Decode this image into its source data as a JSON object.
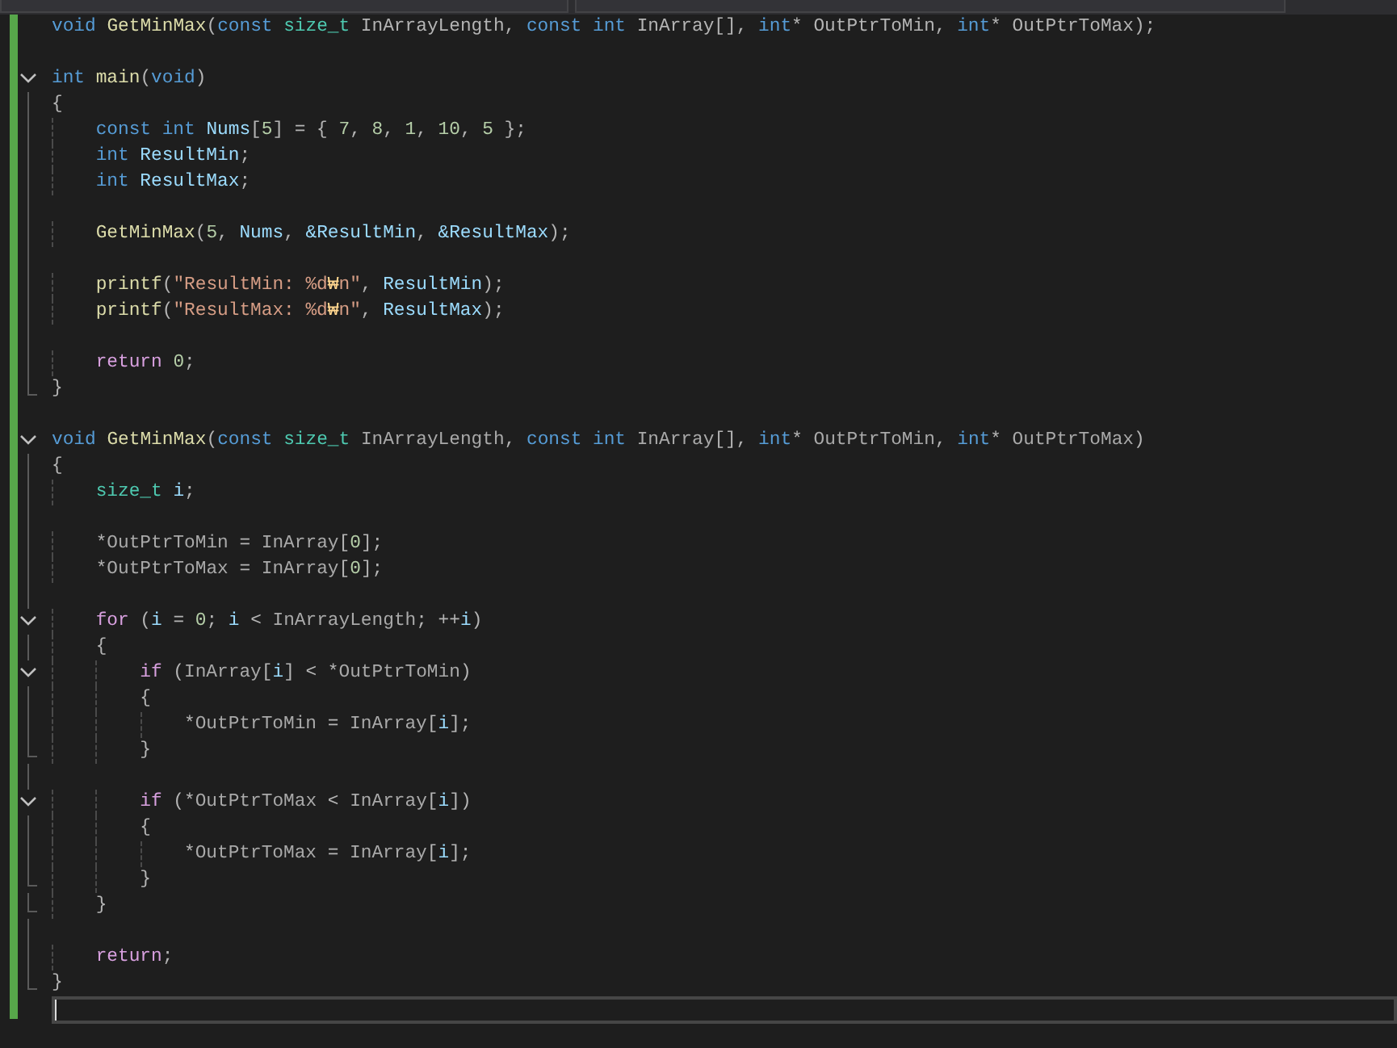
{
  "editor": {
    "lines": [
      {
        "kind": "code",
        "tokens": [
          {
            "text": "void ",
            "kind": "keyword"
          },
          {
            "text": "GetMinMax",
            "kind": "function"
          },
          {
            "text": "(",
            "kind": "plain"
          },
          {
            "text": "const ",
            "kind": "keyword"
          },
          {
            "text": "size_t",
            "kind": "type"
          },
          {
            "text": " InArrayLength, ",
            "kind": "plain"
          },
          {
            "text": "const int",
            "kind": "keyword"
          },
          {
            "text": " InArray[], ",
            "kind": "plain"
          },
          {
            "text": "int",
            "kind": "keyword"
          },
          {
            "text": "* OutPtrToMin, ",
            "kind": "plain"
          },
          {
            "text": "int",
            "kind": "keyword"
          },
          {
            "text": "* OutPtrToMax);",
            "kind": "plain"
          }
        ]
      },
      {
        "kind": "blank"
      },
      {
        "kind": "code",
        "tokens": [
          {
            "text": "int ",
            "kind": "keyword"
          },
          {
            "text": "main",
            "kind": "function"
          },
          {
            "text": "(",
            "kind": "plain"
          },
          {
            "text": "void",
            "kind": "keyword"
          },
          {
            "text": ")",
            "kind": "plain"
          }
        ],
        "children": [
          {
            "kind": "code",
            "tokens": [
              {
                "text": "{",
                "kind": "plain"
              }
            ]
          },
          {
            "kind": "code",
            "tokens": [
              {
                "text": "    const int ",
                "kind": "keyword"
              },
              {
                "text": "Nums",
                "kind": "variable"
              },
              {
                "text": "[",
                "kind": "plain"
              },
              {
                "text": "5",
                "kind": "number"
              },
              {
                "text": "] = { ",
                "kind": "plain"
              },
              {
                "text": "7",
                "kind": "number"
              },
              {
                "text": ", ",
                "kind": "plain"
              },
              {
                "text": "8",
                "kind": "number"
              },
              {
                "text": ", ",
                "kind": "plain"
              },
              {
                "text": "1",
                "kind": "number"
              },
              {
                "text": ", ",
                "kind": "plain"
              },
              {
                "text": "10",
                "kind": "number"
              },
              {
                "text": ", ",
                "kind": "plain"
              },
              {
                "text": "5",
                "kind": "number"
              },
              {
                "text": " };",
                "kind": "plain"
              }
            ]
          },
          {
            "kind": "code",
            "tokens": [
              {
                "text": "    int ",
                "kind": "keyword"
              },
              {
                "text": "ResultMin",
                "kind": "variable"
              },
              {
                "text": ";",
                "kind": "plain"
              }
            ]
          },
          {
            "kind": "code",
            "tokens": [
              {
                "text": "    int ",
                "kind": "keyword"
              },
              {
                "text": "ResultMax",
                "kind": "variable"
              },
              {
                "text": ";",
                "kind": "plain"
              }
            ]
          },
          {
            "kind": "blank"
          },
          {
            "kind": "code",
            "tokens": [
              {
                "text": "    GetMinMax",
                "kind": "function"
              },
              {
                "text": "(",
                "kind": "plain"
              },
              {
                "text": "5",
                "kind": "number"
              },
              {
                "text": ", ",
                "kind": "plain"
              },
              {
                "text": "Nums",
                "kind": "variable"
              },
              {
                "text": ", ",
                "kind": "plain"
              },
              {
                "text": "&ResultMin",
                "kind": "variable"
              },
              {
                "text": ", ",
                "kind": "plain"
              },
              {
                "text": "&ResultMax",
                "kind": "variable"
              },
              {
                "text": ");",
                "kind": "plain"
              }
            ]
          },
          {
            "kind": "blank"
          },
          {
            "kind": "code",
            "tokens": [
              {
                "text": "    printf",
                "kind": "function"
              },
              {
                "text": "(",
                "kind": "plain"
              },
              {
                "text": "\"ResultMin: %d",
                "kind": "string"
              },
              {
                "text": "₩",
                "kind": "escape"
              },
              {
                "text": "n\"",
                "kind": "string"
              },
              {
                "text": ", ",
                "kind": "plain"
              },
              {
                "text": "ResultMin",
                "kind": "variable"
              },
              {
                "text": ");",
                "kind": "plain"
              }
            ]
          },
          {
            "kind": "code",
            "tokens": [
              {
                "text": "    printf",
                "kind": "function"
              },
              {
                "text": "(",
                "kind": "plain"
              },
              {
                "text": "\"ResultMax: %d",
                "kind": "string"
              },
              {
                "text": "₩",
                "kind": "escape"
              },
              {
                "text": "n\"",
                "kind": "string"
              },
              {
                "text": ", ",
                "kind": "plain"
              },
              {
                "text": "ResultMax",
                "kind": "variable"
              },
              {
                "text": ");",
                "kind": "plain"
              }
            ]
          },
          {
            "kind": "blank"
          },
          {
            "kind": "code",
            "tokens": [
              {
                "text": "    return ",
                "kind": "control"
              },
              {
                "text": "0",
                "kind": "number"
              },
              {
                "text": ";",
                "kind": "plain"
              }
            ]
          },
          {
            "kind": "code",
            "tokens": [
              {
                "text": "}",
                "kind": "plain"
              }
            ]
          }
        ]
      },
      {
        "kind": "blank"
      },
      {
        "kind": "code",
        "tokens": [
          {
            "text": "void ",
            "kind": "keyword"
          },
          {
            "text": "GetMinMax",
            "kind": "function"
          },
          {
            "text": "(",
            "kind": "plain"
          },
          {
            "text": "const ",
            "kind": "keyword"
          },
          {
            "text": "size_t ",
            "kind": "type"
          },
          {
            "text": "InArrayLength",
            "kind": "parameter"
          },
          {
            "text": ", ",
            "kind": "plain"
          },
          {
            "text": "const int ",
            "kind": "keyword"
          },
          {
            "text": "InArray",
            "kind": "parameter"
          },
          {
            "text": "[], ",
            "kind": "plain"
          },
          {
            "text": "int",
            "kind": "keyword"
          },
          {
            "text": "* ",
            "kind": "plain"
          },
          {
            "text": "OutPtrToMin",
            "kind": "parameter"
          },
          {
            "text": ", ",
            "kind": "plain"
          },
          {
            "text": "int",
            "kind": "keyword"
          },
          {
            "text": "* ",
            "kind": "plain"
          },
          {
            "text": "OutPtrToMax",
            "kind": "parameter"
          },
          {
            "text": ")",
            "kind": "plain"
          }
        ],
        "children": [
          {
            "kind": "code",
            "tokens": [
              {
                "text": "{",
                "kind": "plain"
              }
            ]
          },
          {
            "kind": "code",
            "tokens": [
              {
                "text": "    size_t ",
                "kind": "type"
              },
              {
                "text": "i",
                "kind": "variable"
              },
              {
                "text": ";",
                "kind": "plain"
              }
            ]
          },
          {
            "kind": "blank"
          },
          {
            "kind": "code",
            "tokens": [
              {
                "text": "    *",
                "kind": "plain"
              },
              {
                "text": "OutPtrToMin",
                "kind": "parameter"
              },
              {
                "text": " = ",
                "kind": "plain"
              },
              {
                "text": "InArray",
                "kind": "parameter"
              },
              {
                "text": "[",
                "kind": "plain"
              },
              {
                "text": "0",
                "kind": "number"
              },
              {
                "text": "];",
                "kind": "plain"
              }
            ]
          },
          {
            "kind": "code",
            "tokens": [
              {
                "text": "    *",
                "kind": "plain"
              },
              {
                "text": "OutPtrToMax",
                "kind": "parameter"
              },
              {
                "text": " = ",
                "kind": "plain"
              },
              {
                "text": "InArray",
                "kind": "parameter"
              },
              {
                "text": "[",
                "kind": "plain"
              },
              {
                "text": "0",
                "kind": "number"
              },
              {
                "text": "];",
                "kind": "plain"
              }
            ]
          },
          {
            "kind": "blank"
          },
          {
            "kind": "code",
            "tokens": [
              {
                "text": "    for ",
                "kind": "control"
              },
              {
                "text": "(",
                "kind": "plain"
              },
              {
                "text": "i",
                "kind": "variable"
              },
              {
                "text": " = ",
                "kind": "plain"
              },
              {
                "text": "0",
                "kind": "number"
              },
              {
                "text": "; ",
                "kind": "plain"
              },
              {
                "text": "i",
                "kind": "variable"
              },
              {
                "text": " < ",
                "kind": "plain"
              },
              {
                "text": "InArrayLength",
                "kind": "parameter"
              },
              {
                "text": "; ++",
                "kind": "plain"
              },
              {
                "text": "i",
                "kind": "variable"
              },
              {
                "text": ")",
                "kind": "plain"
              }
            ],
            "children": [
              {
                "kind": "code",
                "tokens": [
                  {
                    "text": "    {",
                    "kind": "plain"
                  }
                ]
              },
              {
                "kind": "code",
                "tokens": [
                  {
                    "text": "        if ",
                    "kind": "control"
                  },
                  {
                    "text": "(",
                    "kind": "plain"
                  },
                  {
                    "text": "InArray",
                    "kind": "parameter"
                  },
                  {
                    "text": "[",
                    "kind": "plain"
                  },
                  {
                    "text": "i",
                    "kind": "variable"
                  },
                  {
                    "text": "] < *",
                    "kind": "plain"
                  },
                  {
                    "text": "OutPtrToMin",
                    "kind": "parameter"
                  },
                  {
                    "text": ")",
                    "kind": "plain"
                  }
                ],
                "children": [
                  {
                    "kind": "code",
                    "tokens": [
                      {
                        "text": "        {",
                        "kind": "plain"
                      }
                    ]
                  },
                  {
                    "kind": "code",
                    "tokens": [
                      {
                        "text": "            *",
                        "kind": "plain"
                      },
                      {
                        "text": "OutPtrToMin",
                        "kind": "parameter"
                      },
                      {
                        "text": " = ",
                        "kind": "plain"
                      },
                      {
                        "text": "InArray",
                        "kind": "parameter"
                      },
                      {
                        "text": "[",
                        "kind": "plain"
                      },
                      {
                        "text": "i",
                        "kind": "variable"
                      },
                      {
                        "text": "];",
                        "kind": "plain"
                      }
                    ]
                  },
                  {
                    "kind": "code",
                    "tokens": [
                      {
                        "text": "        }",
                        "kind": "plain"
                      }
                    ]
                  }
                ]
              },
              {
                "kind": "blank"
              },
              {
                "kind": "code",
                "tokens": [
                  {
                    "text": "        if ",
                    "kind": "control"
                  },
                  {
                    "text": "(*",
                    "kind": "plain"
                  },
                  {
                    "text": "OutPtrToMax",
                    "kind": "parameter"
                  },
                  {
                    "text": " < ",
                    "kind": "plain"
                  },
                  {
                    "text": "InArray",
                    "kind": "parameter"
                  },
                  {
                    "text": "[",
                    "kind": "plain"
                  },
                  {
                    "text": "i",
                    "kind": "variable"
                  },
                  {
                    "text": "])",
                    "kind": "plain"
                  }
                ],
                "children": [
                  {
                    "kind": "code",
                    "tokens": [
                      {
                        "text": "        {",
                        "kind": "plain"
                      }
                    ]
                  },
                  {
                    "kind": "code",
                    "tokens": [
                      {
                        "text": "            *",
                        "kind": "plain"
                      },
                      {
                        "text": "OutPtrToMax",
                        "kind": "parameter"
                      },
                      {
                        "text": " = ",
                        "kind": "plain"
                      },
                      {
                        "text": "InArray",
                        "kind": "parameter"
                      },
                      {
                        "text": "[",
                        "kind": "plain"
                      },
                      {
                        "text": "i",
                        "kind": "variable"
                      },
                      {
                        "text": "];",
                        "kind": "plain"
                      }
                    ]
                  },
                  {
                    "kind": "code",
                    "tokens": [
                      {
                        "text": "        }",
                        "kind": "plain"
                      }
                    ]
                  }
                ]
              },
              {
                "kind": "code",
                "tokens": [
                  {
                    "text": "    }",
                    "kind": "plain"
                  }
                ]
              }
            ]
          },
          {
            "kind": "blank"
          },
          {
            "kind": "code",
            "tokens": [
              {
                "text": "    return",
                "kind": "control"
              },
              {
                "text": ";",
                "kind": "plain"
              }
            ]
          },
          {
            "kind": "code",
            "tokens": [
              {
                "text": "}",
                "kind": "plain"
              }
            ]
          }
        ]
      },
      {
        "kind": "blank",
        "current": true
      }
    ]
  }
}
